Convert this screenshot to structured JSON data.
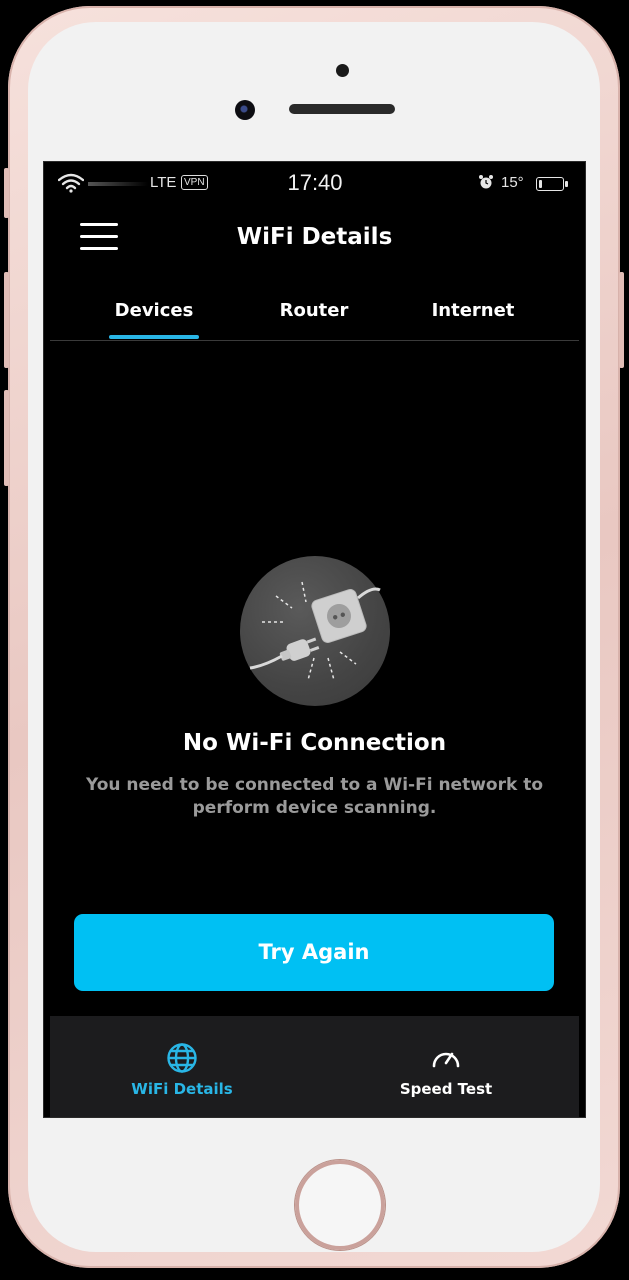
{
  "status_bar": {
    "network": "LTE",
    "vpn": "VPN",
    "time": "17:40",
    "battery_text": "15°",
    "battery_level": 0.15
  },
  "header": {
    "title": "WiFi Details",
    "menu_icon": "hamburger-menu-icon"
  },
  "tabs": [
    {
      "label": "Devices",
      "active": true
    },
    {
      "label": "Router",
      "active": false
    },
    {
      "label": "Internet",
      "active": false
    }
  ],
  "empty_state": {
    "illustration": "unplugged-plug-icon",
    "title": "No Wi-Fi Connection",
    "description": "You need to be connected to a Wi-Fi network to perform device scanning."
  },
  "primary_action": {
    "label": "Try Again"
  },
  "bottom_nav": [
    {
      "label": "WiFi Details",
      "icon": "globe-icon",
      "active": true
    },
    {
      "label": "Speed Test",
      "icon": "speedometer-icon",
      "active": false
    }
  ],
  "colors": {
    "accent": "#29b6e6",
    "button": "#00c0f3",
    "background": "#000000",
    "nav_background": "#1c1c1e",
    "muted_text": "#9a9a9a"
  }
}
